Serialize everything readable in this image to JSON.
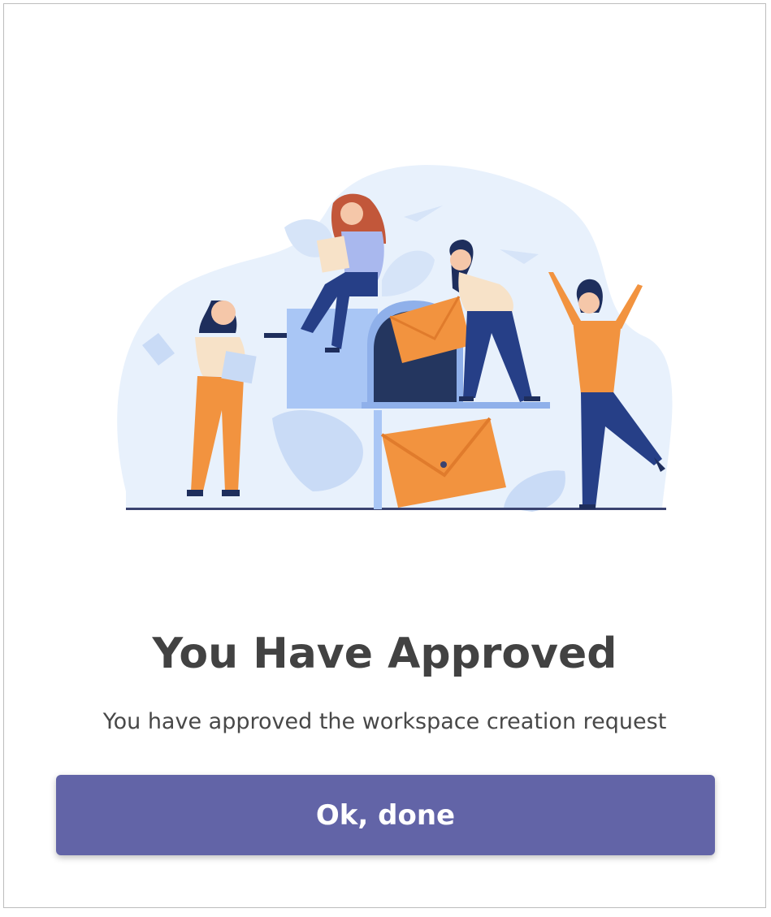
{
  "dialog": {
    "title": "You Have Approved",
    "message": "You have approved the workspace creation request",
    "button_label": "Ok, done"
  },
  "colors": {
    "button": "#6264a7",
    "title_text": "#424242",
    "blob": "#e8f1fc",
    "mailbox": "#a9c6f5",
    "navy": "#263f87",
    "orange": "#f2933f",
    "envelope_dark": "#e07b2c"
  },
  "illustration": {
    "name": "people-with-mailbox-and-envelopes"
  }
}
